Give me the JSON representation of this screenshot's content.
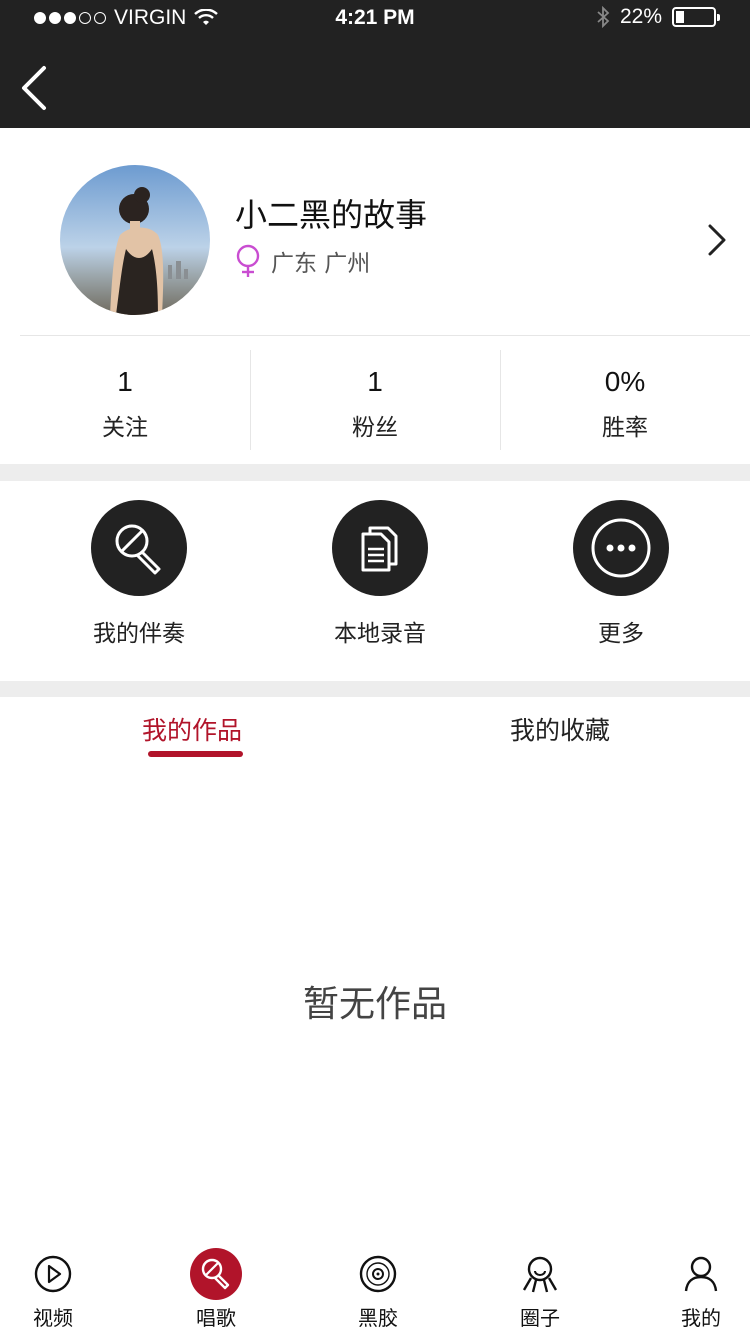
{
  "status_bar": {
    "carrier": "VIRGIN",
    "time": "4:21 PM",
    "battery_text": "22%",
    "battery_level": 0.22
  },
  "profile": {
    "nickname": "小二黑的故事",
    "location": "广东 广州",
    "gender": "female"
  },
  "stats": [
    {
      "value": "1",
      "label": "关注"
    },
    {
      "value": "1",
      "label": "粉丝"
    },
    {
      "value": "0%",
      "label": "胜率"
    }
  ],
  "actions": [
    {
      "label": "我的伴奏",
      "icon": "microphone-icon"
    },
    {
      "label": "本地录音",
      "icon": "documents-icon"
    },
    {
      "label": "更多",
      "icon": "more-dots-icon"
    }
  ],
  "tabs": [
    {
      "label": "我的作品",
      "active": true
    },
    {
      "label": "我的收藏",
      "active": false
    }
  ],
  "empty_text": "暂无作品",
  "tabbar": [
    {
      "label": "视频",
      "icon": "play-icon",
      "active": false
    },
    {
      "label": "唱歌",
      "icon": "microphone-icon",
      "active": true
    },
    {
      "label": "黑胶",
      "icon": "vinyl-icon",
      "active": false
    },
    {
      "label": "圈子",
      "icon": "community-icon",
      "active": false
    },
    {
      "label": "我的",
      "icon": "person-icon",
      "active": false
    }
  ],
  "colors": {
    "accent": "#b1142a",
    "nav_bg": "#222222",
    "gender_female": "#c94dd1",
    "divider": "#ededed"
  }
}
